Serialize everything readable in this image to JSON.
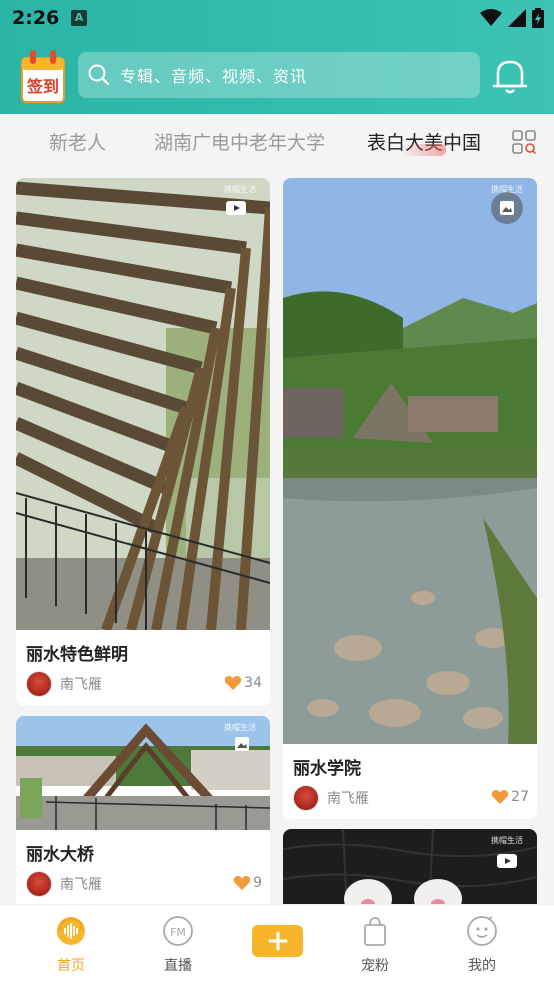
{
  "status": {
    "time": "2:26",
    "notice_letter": "A"
  },
  "search": {
    "placeholder": "专辑、音频、视频、资讯"
  },
  "logo": {
    "text": "签到"
  },
  "tabs": [
    {
      "label": "新老人",
      "active": false
    },
    {
      "label": "湖南广电中老年大学",
      "active": false
    },
    {
      "label": "表白大美中国",
      "active": true
    }
  ],
  "cards": [
    {
      "title": "丽水特色鲜明",
      "author": "南飞雁",
      "likes": "34",
      "media": "video-icon",
      "watermark": "携帽生活"
    },
    {
      "title": "丽水学院",
      "author": "南飞雁",
      "likes": "27",
      "media": "image-icon",
      "watermark": "携帽生活"
    },
    {
      "title": "丽水大桥",
      "author": "南飞雁",
      "likes": "9",
      "media": "image-icon",
      "watermark": "携帽生活"
    },
    {
      "title": "",
      "author": "",
      "likes": "",
      "media": "video-icon",
      "watermark": "携帽生活"
    }
  ],
  "bottom_nav": [
    {
      "label": "首页",
      "icon": "home-audio-icon",
      "active": true
    },
    {
      "label": "直播",
      "icon": "fm-radio-icon",
      "active": false
    },
    {
      "label": "",
      "icon": "plus-icon",
      "active": false
    },
    {
      "label": "宠粉",
      "icon": "shopping-bag-icon",
      "active": false
    },
    {
      "label": "我的",
      "icon": "profile-face-icon",
      "active": false
    }
  ],
  "colors": {
    "header": "#2bb5a6",
    "accent": "#f4a623",
    "like": "#f29a3a"
  }
}
